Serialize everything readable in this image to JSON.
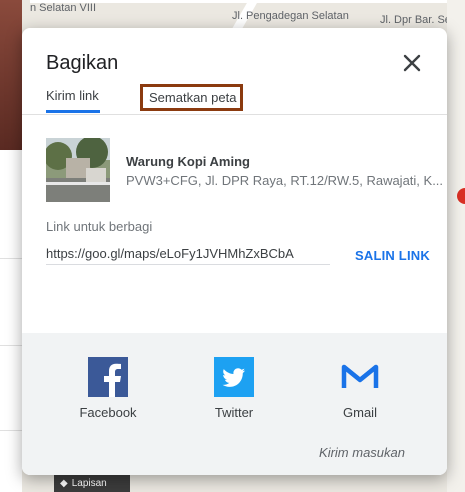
{
  "map": {
    "labels": [
      "n Selatan VIII",
      "Jl. Pengadegan Selatan",
      "Jl. Dpr Bar. Selatan",
      "Lapisan"
    ]
  },
  "dialog": {
    "title": "Bagikan",
    "tabs": [
      {
        "label": "Kirim link"
      },
      {
        "label": "Sematkan peta"
      }
    ],
    "place": {
      "name": "Warung Kopi Aming",
      "address": "PVW3+CFG, Jl. DPR Raya, RT.12/RW.5, Rawajati, K..."
    },
    "link": {
      "label": "Link untuk berbagi",
      "value": "https://goo.gl/maps/eLoFy1JVHMhZxBCbA",
      "copy_label": "SALIN LINK"
    },
    "share": {
      "facebook": "Facebook",
      "twitter": "Twitter",
      "gmail": "Gmail"
    },
    "feedback": "Kirim masukan",
    "colors": {
      "accent": "#1a73e8",
      "tab_highlight": "#8b3a0f",
      "facebook": "#3b5998",
      "twitter": "#1da1f2",
      "gmail": "#1a73e8"
    }
  }
}
